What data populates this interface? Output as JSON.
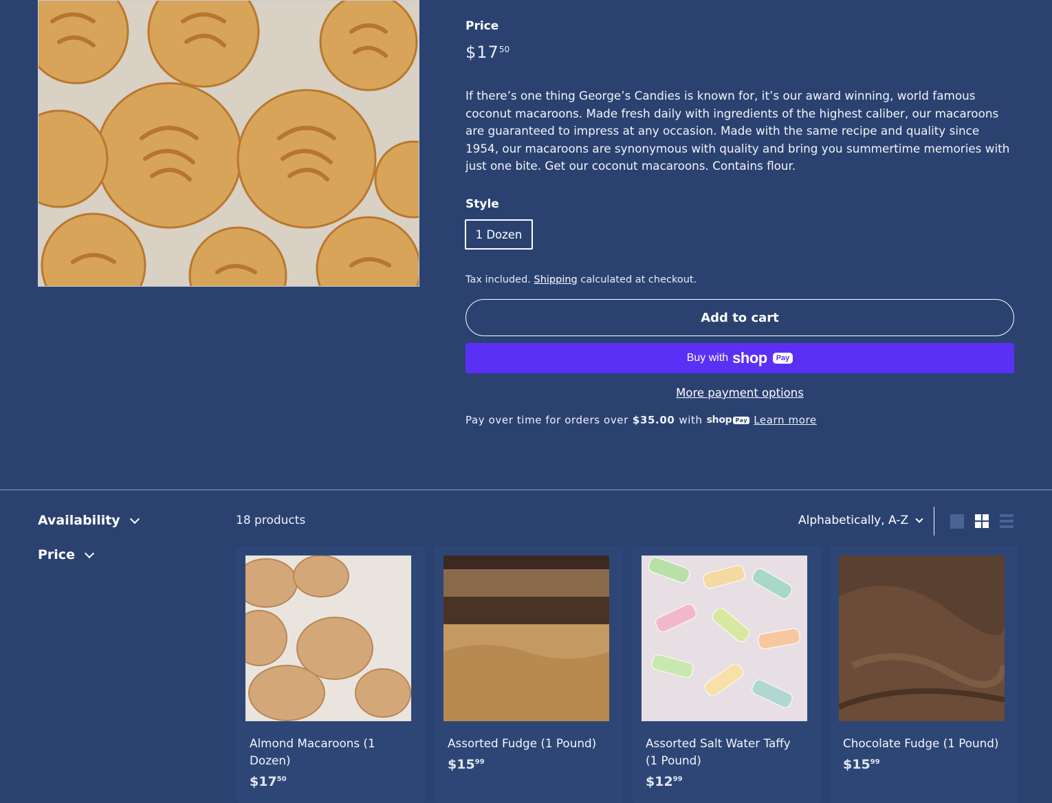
{
  "product": {
    "price_label": "Price",
    "price_dollars": "$17",
    "price_cents": "50",
    "description": "If there’s one thing George’s Candies is known for, it’s our award winning, world famous coconut macaroons. Made fresh daily with ingredients of the highest caliber, our macaroons are guaranteed to impress at any occasion. Made with the same recipe and quality since 1954, our macaroons are synonymous with quality and bring you summertime memories with just one bite. Get our coconut macaroons. Contains flour.",
    "style_label": "Style",
    "style_option": "1 Dozen",
    "tax_prefix": "Tax included.",
    "tax_link": "Shipping",
    "tax_suffix": "calculated at checkout.",
    "add_to_cart": "Add to cart",
    "buy_with": "Buy with",
    "shop_word": "shop",
    "pay_word": "Pay",
    "more_options": "More payment options",
    "installments_prefix": "Pay over time for orders over",
    "installments_amount": "$35.00",
    "installments_with": "with",
    "learn_more": "Learn more"
  },
  "colors": {
    "background": "#2b4271",
    "shop_pay": "#5a31f4"
  },
  "filters": {
    "availability": "Availability",
    "price": "Price"
  },
  "collection": {
    "count": "18 products",
    "sort": "Alphabetically, A-Z",
    "view_icons": [
      "grid-large-icon",
      "grid-small-icon",
      "list-view-icon"
    ]
  },
  "products": [
    {
      "title": "Almond Macaroons (1 Dozen)",
      "price_dollars": "$17",
      "price_cents": "50"
    },
    {
      "title": "Assorted Fudge (1 Pound)",
      "price_dollars": "$15",
      "price_cents": "99"
    },
    {
      "title": "Assorted Salt Water Taffy (1 Pound)",
      "price_dollars": "$12",
      "price_cents": "99"
    },
    {
      "title": "Chocolate Fudge (1 Pound)",
      "price_dollars": "$15",
      "price_cents": "99"
    }
  ]
}
